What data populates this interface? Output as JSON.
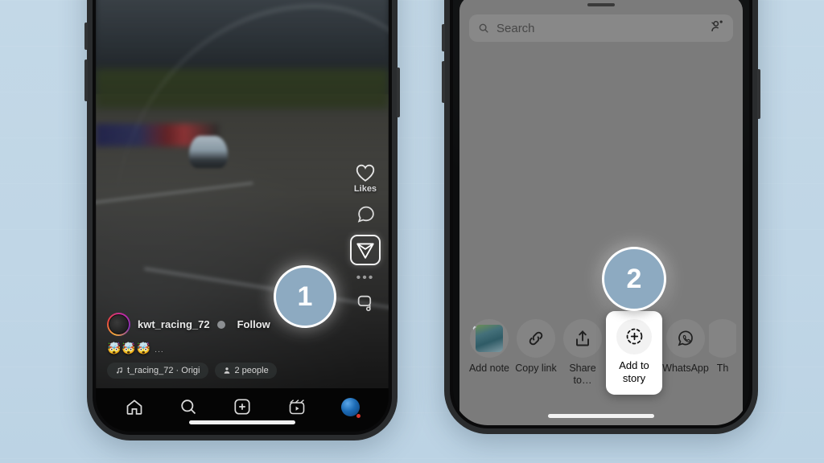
{
  "background": {
    "color": "#bed4e5"
  },
  "steps": [
    {
      "name": "step-1",
      "label": "1"
    },
    {
      "name": "step-2",
      "label": "2"
    }
  ],
  "left_phone": {
    "app": "Instagram Reels",
    "video": {
      "description": "blurred racing circuit video with white race car"
    },
    "action_rail": {
      "like_label": "Likes",
      "comment_icon": "comment-icon",
      "share_icon": "paper-plane-icon",
      "more_dots": "•••",
      "audio_icon": "audio-remix-icon"
    },
    "meta": {
      "username": "kwt_racing_72",
      "verified": true,
      "follow_label": "Follow",
      "caption": "🤯🤯🤯",
      "caption_more": "...",
      "music_pill": "t_racing_72 · Origi",
      "people_pill": "2 people"
    },
    "tabbar": [
      {
        "name": "tab-home",
        "icon": "home-icon"
      },
      {
        "name": "tab-search",
        "icon": "search-icon"
      },
      {
        "name": "tab-create",
        "icon": "plus-square-icon"
      },
      {
        "name": "tab-reels",
        "icon": "reels-icon"
      },
      {
        "name": "tab-profile",
        "icon": "avatar-icon"
      }
    ]
  },
  "right_phone": {
    "sheet": {
      "search_placeholder": "Search",
      "add_person_icon": "add-person-icon",
      "items": [
        {
          "name": "share-item-add-note",
          "label": "Add note",
          "icon": "note-thumbnail-icon",
          "highlighted": false
        },
        {
          "name": "share-item-copy-link",
          "label": "Copy link",
          "icon": "link-icon",
          "highlighted": false
        },
        {
          "name": "share-item-share-to",
          "label": "Share to…",
          "icon": "share-arrow-icon",
          "highlighted": false
        },
        {
          "name": "share-item-add-to-story",
          "label": "Add to story",
          "icon": "add-to-story-icon",
          "highlighted": true
        },
        {
          "name": "share-item-whatsapp",
          "label": "WhatsApp",
          "icon": "whatsapp-icon",
          "highlighted": false
        },
        {
          "name": "share-item-threads",
          "label": "Th",
          "icon": "threads-icon",
          "highlighted": false
        }
      ]
    }
  }
}
